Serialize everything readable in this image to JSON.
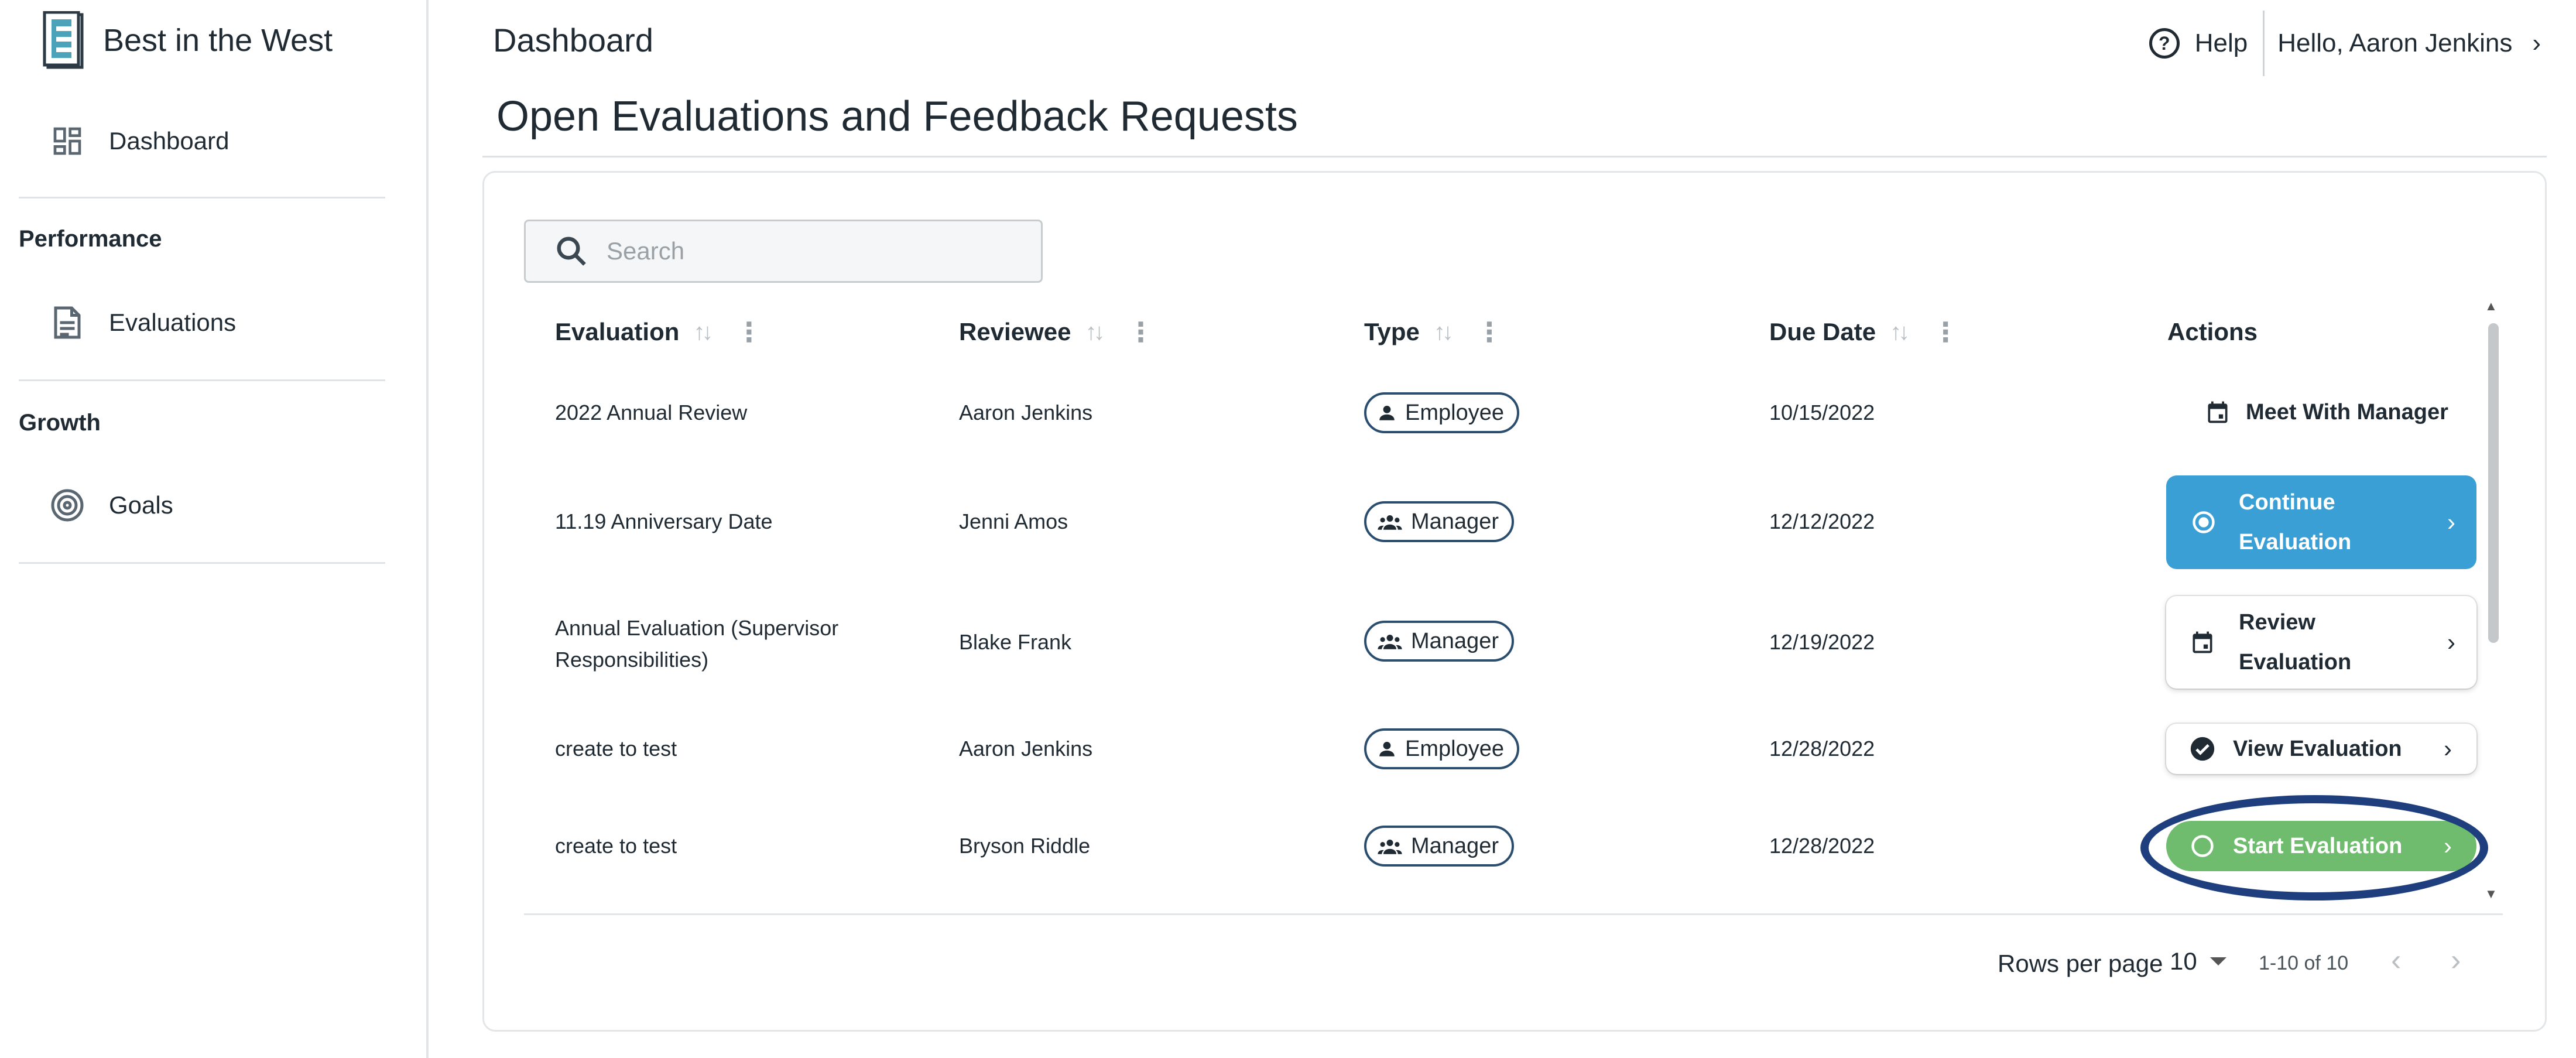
{
  "app": {
    "title": "Best in the West"
  },
  "sidebar": {
    "dashboard_label": "Dashboard",
    "sections": [
      {
        "title": "Performance",
        "items": [
          {
            "label": "Evaluations",
            "icon": "document-icon"
          }
        ]
      },
      {
        "title": "Growth",
        "items": [
          {
            "label": "Goals",
            "icon": "target-icon"
          }
        ]
      }
    ]
  },
  "header": {
    "title": "Dashboard",
    "help_label": "Help",
    "greeting": "Hello, Aaron Jenkins"
  },
  "main": {
    "section_title": "Open Evaluations and Feedback Requests",
    "search": {
      "placeholder": "Search",
      "value": ""
    },
    "columns": [
      "Evaluation",
      "Reviewee",
      "Type",
      "Due Date",
      "Actions"
    ],
    "rows": [
      {
        "evaluation": "2022 Annual Review",
        "reviewee": "Aaron Jenkins",
        "type": "Employee",
        "due": "10/15/2022",
        "action": "Meet With Manager",
        "action_style": "flat",
        "action_icon": "calendar-icon"
      },
      {
        "evaluation": "11.19 Anniversary Date",
        "reviewee": "Jenni Amos",
        "type": "Manager",
        "due": "12/12/2022",
        "action": "Continue Evaluation",
        "action_line1": "Continue",
        "action_line2": "Evaluation",
        "action_style": "blue",
        "action_icon": "radio-dot-icon"
      },
      {
        "evaluation": "Annual Evaluation (Supervisor Responsibilities)",
        "evaluation_line1": "Annual Evaluation (Supervisor",
        "evaluation_line2": "Responsibilities)",
        "reviewee": "Blake Frank",
        "type": "Manager",
        "due": "12/19/2022",
        "action": "Review Evaluation",
        "action_line1": "Review",
        "action_line2": "Evaluation",
        "action_style": "outlined",
        "action_icon": "calendar-icon"
      },
      {
        "evaluation": "create to test",
        "reviewee": "Aaron Jenkins",
        "type": "Employee",
        "due": "12/28/2022",
        "action": "View Evaluation",
        "action_style": "outlined",
        "action_icon": "check-circle-icon"
      },
      {
        "evaluation": "create to test",
        "reviewee": "Bryson Riddle",
        "type": "Manager",
        "due": "12/28/2022",
        "action": "Start Evaluation",
        "action_style": "green",
        "action_icon": "circle-outline-icon"
      }
    ],
    "pagination": {
      "rows_per_page_label": "Rows per page",
      "rows_per_page": "10",
      "range": "1-10 of 10"
    }
  },
  "colors": {
    "primary_blue": "#3a9fd5",
    "success_green": "#6fbc6f",
    "chip_border": "#2b4d6e",
    "highlight_ring": "#1e3e7e",
    "text": "#1f2a33"
  }
}
